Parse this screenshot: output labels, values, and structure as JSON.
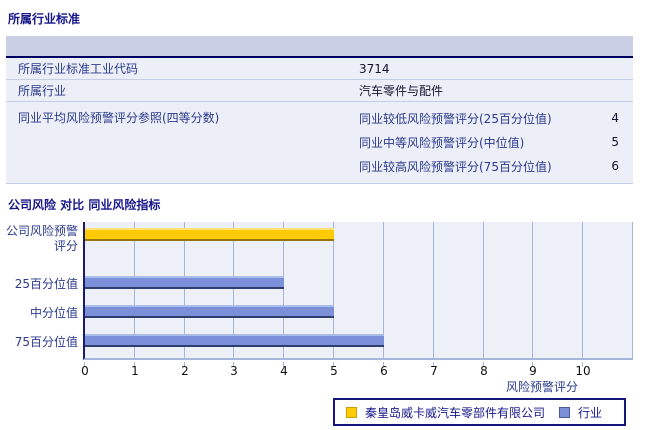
{
  "section1": {
    "title": "所属行业标准"
  },
  "industry_table": {
    "row_sic": {
      "label": "所属行业标准工业代码",
      "value": "3714"
    },
    "row_industry": {
      "label": "所属行业",
      "value": "汽车零件与配件"
    },
    "row_peer_group": {
      "label": "同业平均风险预警评分参照(四等分数)",
      "sub_rows": [
        {
          "label": "同业较低风险预警评分(25百分位值)",
          "value": "4"
        },
        {
          "label": "同业中等风险预警评分(中位值)",
          "value": "5"
        },
        {
          "label": "同业较高风险预警评分(75百分位值)",
          "value": "6"
        }
      ]
    }
  },
  "section2": {
    "title": "公司风险 对比 同业风险指标"
  },
  "chart_data": {
    "type": "bar",
    "orientation": "horizontal",
    "title": "公司风险 对比 同业风险指标",
    "categories": [
      "公司风险预警评分",
      "25百分位值",
      "中分位值",
      "75百分位值"
    ],
    "values": [
      5,
      4,
      5,
      6
    ],
    "bar_series": [
      "company",
      "industry",
      "industry",
      "industry"
    ],
    "xlabel": "风险预警评分",
    "xlim": [
      0,
      11
    ],
    "xticks": [
      0,
      1,
      2,
      3,
      4,
      5,
      6,
      7,
      8,
      9,
      10
    ],
    "grid": true,
    "legend_position": "below-right",
    "series_colors": {
      "company": "#FFCB05",
      "industry": "#7B90D8"
    },
    "legend": [
      {
        "series": "company",
        "label": "秦皇岛威卡威汽车零部件有限公司",
        "color": "#FFCB05"
      },
      {
        "series": "industry",
        "label": "行业",
        "color": "#7B90D8"
      }
    ]
  },
  "colors": {
    "title_navy": "#17178b",
    "table_header_band": "#c9cfe4",
    "table_header_border": "#000060",
    "table_row_bg": "#eceff7",
    "plot_bg": "#edf0f6",
    "gridline": "#a5b5dc",
    "axis_navy": "#1a1a70",
    "bar_company": "#ffcb05",
    "bar_industry": "#7b90d8"
  }
}
